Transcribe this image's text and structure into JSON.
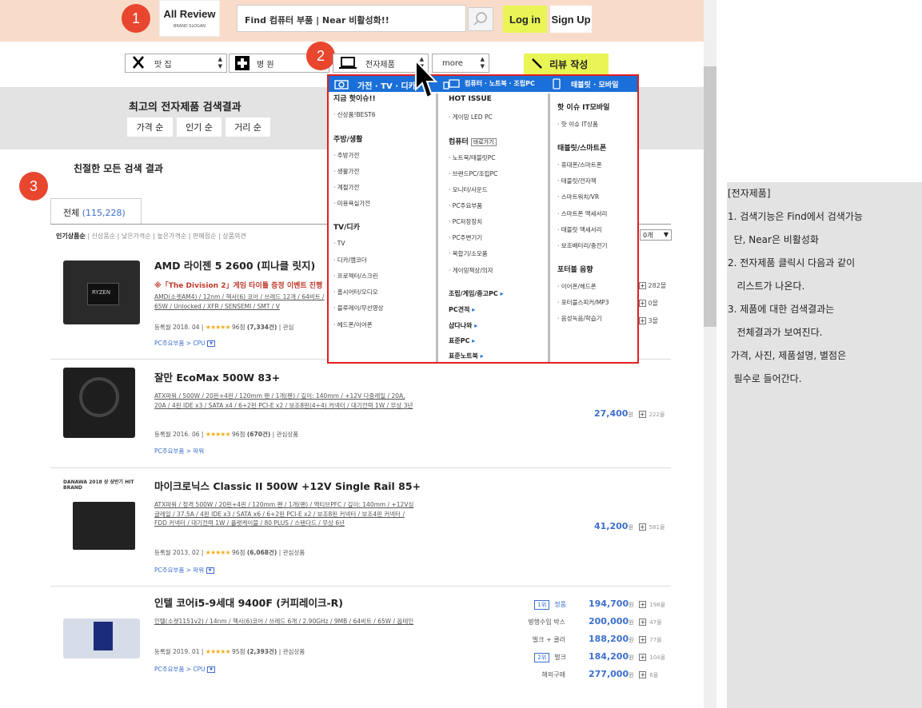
{
  "header": {
    "logo_title": "All Review",
    "logo_slogan": "BRAND SLOGAN",
    "search_text": "Find  컴퓨터 부품              | Near  비활성화!!",
    "login_label": "Log in",
    "signup_label": "Sign Up"
  },
  "markers": [
    "1",
    "2",
    "3"
  ],
  "categories": {
    "restaurant": "맛 집",
    "hospital": "병 원",
    "electronics": "전자제품",
    "more": "more",
    "write_review": "리뷰 작성"
  },
  "results_banner": {
    "title": "최고의 전자제품 검색결과",
    "sorts": [
      "가격 순",
      "인기 순",
      "거리 순"
    ]
  },
  "section_title": "친절한 모든 검색 결과",
  "tab": {
    "label": "전체",
    "count": "(115,228)"
  },
  "sortbar": {
    "active": "인기상품순",
    "others": [
      "신상품순",
      "낮은가격순",
      "높은가격순",
      "판매점순",
      "상품의견"
    ],
    "count_select": "0개"
  },
  "dropdown": {
    "tabs": [
      "가전 · TV · 디카",
      "컴퓨터 · 노트북 · 조립PC",
      "태블릿 · 모바일"
    ],
    "col1": {
      "groups": [
        {
          "title": "지금 핫이슈!!",
          "items": [
            "신상품!BEST6"
          ]
        },
        {
          "title": "주방/생활",
          "items": [
            "주방가전",
            "생활가전",
            "계절가전",
            "미용욕실가전"
          ]
        },
        {
          "title": "TV/디카",
          "items": [
            "TV",
            "디카/캠코더",
            "프로젝터/스크린",
            "홈시어터/오디오",
            "블루레이/무선영상",
            "헤드폰/이어폰"
          ]
        }
      ]
    },
    "col2": {
      "hot_title": "HOT ISSUE",
      "hot_items": [
        "게이밍 LED PC"
      ],
      "computer_title": "컴퓨터",
      "shortcut": "바로가기",
      "computer_items": [
        "노트북/태블릿PC",
        "브랜드PC/조립PC",
        "모니터/사운드",
        "PC주요부품",
        "PC저장장치",
        "PC주변기기",
        "복합기/소모품",
        "게이밍책상/의자"
      ],
      "links": [
        "조립/게임/중고PC",
        "PC견적",
        "샵다나와",
        "표준PC",
        "표준노트북"
      ]
    },
    "col3": {
      "groups": [
        {
          "title": "핫 이슈 IT모바일",
          "items": [
            "핫 이슈 IT상품"
          ]
        },
        {
          "title": "태블릿/스마트폰",
          "items": [
            "휴대폰/스마트폰",
            "태블릿/전자책",
            "스마트워치/VR",
            "스마트폰 액세서리",
            "태블릿 액세서리",
            "보조배터리/충전기"
          ]
        },
        {
          "title": "포터블 음향",
          "items": [
            "이어폰/헤드폰",
            "포터블스피커/MP3",
            "음성녹음/학습기"
          ]
        }
      ]
    }
  },
  "products": [
    {
      "name": "AMD 라이젠 5 2600 (피나클 릿지)",
      "promo": "※「The Division 2」게임 타이틀 증정 이벤트 진행",
      "spec": "AMD(소켓AM4) / 12nm / 헥사(6) 코어 / 쓰레드 12개 / 64비트 / 65W / Unlocked / XFR / SENSEMI / SMT / V",
      "date": "등록월 2018. 04",
      "rating": "96점",
      "reviews": "(7,334건)",
      "interest": "관심",
      "category": "PC주요부품 > CPU",
      "side": [
        "282몰",
        "0몰",
        "3몰"
      ]
    },
    {
      "name": "잘만 EcoMax 500W 83+",
      "spec": "ATX파워 / 500W / 20핀+4핀 / 120mm 팬 / 1개(팬) / 깊이: 140mm / +12V 다중레일 / 20A, 20A / 4핀 IDE x3 / SATA x4 / 6+2핀 PCI-E x2 / 보조8핀(4+4) 커넥터 / 대기전력 1W / 무상 3년",
      "date": "등록월 2016. 06",
      "rating": "96점",
      "reviews": "(670건)",
      "interest": "관심상품",
      "category": "PC주요부품 > 파워",
      "price": "27,400",
      "won": "원",
      "malls": "222몰"
    },
    {
      "badge": "DANAWA 2018 상 상반기 HIT BRAND",
      "name": "마이크로닉스 Classic II 500W +12V Single Rail 85+",
      "spec": "ATX파워 / 정격 500W / 20핀+4핀 / 120mm 팬 / 1개(팬) / 액티브PFC / 깊이: 140mm / +12V싱글레일 / 37.5A / 4핀 IDE x3 / SATA x6 / 6+2핀 PCI-E x2 / 보조8핀 커넥터 / 보조4핀 커넥터 / FDD 커넥터 / 대기전력 1W / 플랫케이블 / 80 PLUS / 스탠다드 / 무상 6년",
      "date": "등록월 2013. 02",
      "rating": "96점",
      "reviews": "(6,068건)",
      "interest": "관심상품",
      "category": "PC주요부품 > 파워",
      "price": "41,200",
      "won": "원",
      "malls": "581몰"
    },
    {
      "name": "인텔 코어i5-9세대 9400F (커피레이크-R)",
      "spec": "인텔(소켓1151v2) / 14nm / 헥사(6)코어 / 쓰레드 6개 / 2.90GHz / 9MB / 64비트 / 65W / 옵테인",
      "date": "등록월 2019. 01",
      "rating": "95점",
      "reviews": "(2,393건)",
      "interest": "관심상품",
      "category": "PC주요부품 > CPU",
      "prices": [
        {
          "rank": "1위",
          "label": "정품",
          "price": "194,700",
          "malls": "198몰"
        },
        {
          "rank": "",
          "label": "병행수입 박스",
          "price": "200,000",
          "malls": "47몰"
        },
        {
          "rank": "",
          "label": "벌크 + 쿨러",
          "price": "188,200",
          "malls": "77몰"
        },
        {
          "rank": "2위",
          "label": "벌크",
          "price": "184,200",
          "malls": "104몰"
        },
        {
          "rank": "",
          "label": "해외구매",
          "price": "277,000",
          "malls": "6몰"
        }
      ],
      "won": "원"
    }
  ],
  "notes": {
    "title": "[전자제품]",
    "lines": [
      "1. 검색기능은 Find에서 검색가능",
      "  단, Near은 비활성화",
      "2. 전자제품 클릭시 다음과 같이",
      "   리스트가 나온다.",
      "3. 제품에 대한 검색결과는",
      "   전체결과가 보여진다.",
      " 가격, 사진, 제품설명, 별점은",
      "  필수로 들어간다."
    ]
  },
  "icons": [
    "search-icon",
    "fork-knife-icon",
    "hospital-cross-icon",
    "laptop-icon",
    "pencil-icon",
    "camera-icon",
    "monitor-icon",
    "tablet-icon",
    "cursor-arrow-icon",
    "plus-icon",
    "star-icon"
  ],
  "colors": {
    "accent": "#e8462f",
    "highlight": "#e9f554",
    "header_bg": "#f8dcc9",
    "link": "#3c6fcd",
    "dropdown_head": "#1b6fd8",
    "dropdown_border": "#e02020"
  }
}
